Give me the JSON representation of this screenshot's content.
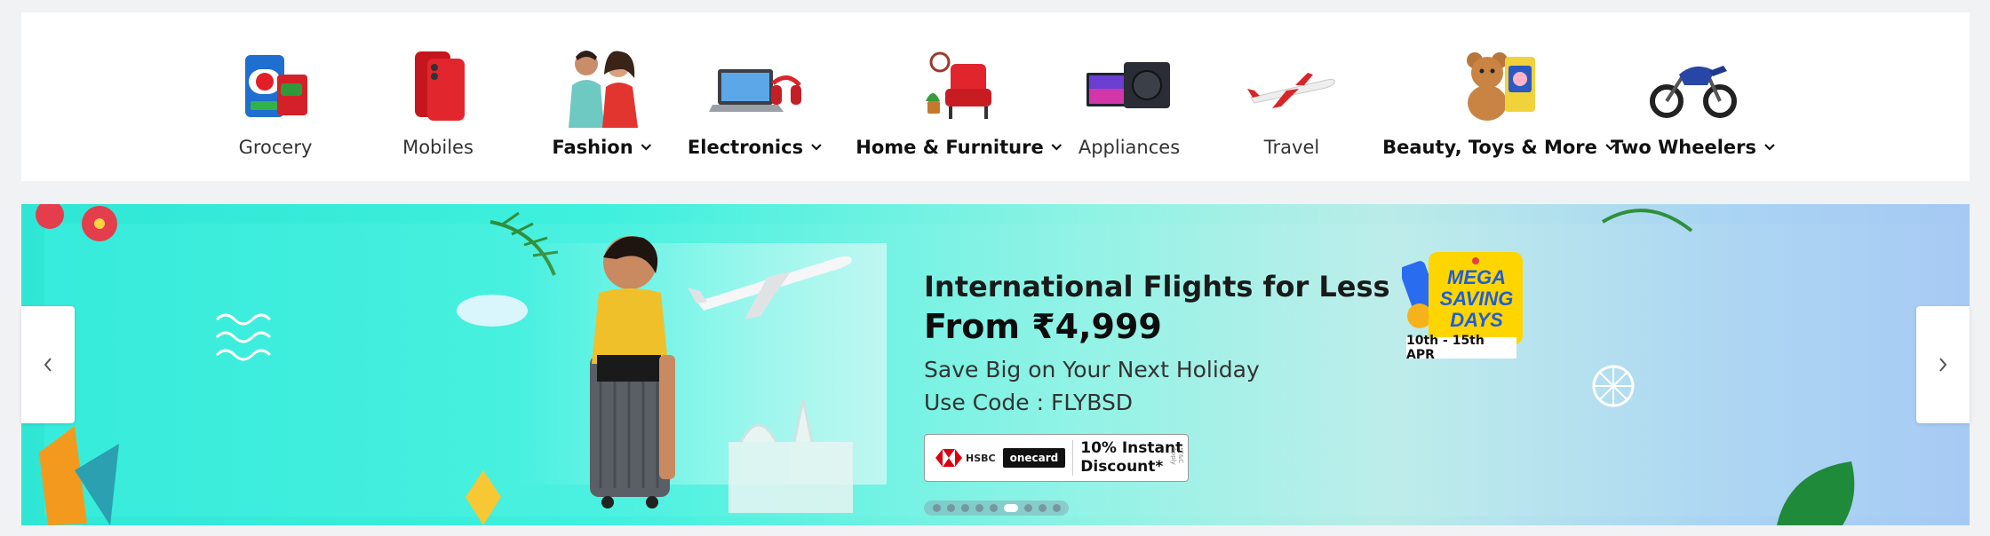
{
  "categories": [
    {
      "label": "Grocery",
      "icon": "grocery-icon",
      "has_dropdown": false
    },
    {
      "label": "Mobiles",
      "icon": "mobiles-icon",
      "has_dropdown": false
    },
    {
      "label": "Fashion",
      "icon": "fashion-icon",
      "has_dropdown": true
    },
    {
      "label": "Electronics",
      "icon": "electronics-icon",
      "has_dropdown": true
    },
    {
      "label": "Home & Furniture",
      "icon": "home-furniture-icon",
      "has_dropdown": true
    },
    {
      "label": "Appliances",
      "icon": "appliances-icon",
      "has_dropdown": false
    },
    {
      "label": "Travel",
      "icon": "travel-icon",
      "has_dropdown": false
    },
    {
      "label": "Beauty, Toys & More",
      "icon": "beauty-toys-icon",
      "has_dropdown": true
    },
    {
      "label": "Two Wheelers",
      "icon": "two-wheelers-icon",
      "has_dropdown": true
    }
  ],
  "banner": {
    "headline": "International Flights for Less",
    "price": "From ₹4,999",
    "subline1": "Save Big on Your Next Holiday",
    "subline2": "Use Code : FLYBSD",
    "offer": {
      "bank1": "HSBC",
      "bank2": "onecard",
      "text_line1": "10% Instant",
      "text_line2": "Discount*",
      "tnc": "*T&C Apply"
    },
    "badge": {
      "line1": "MEGA",
      "line2": "SAVING",
      "line3": "DAYS",
      "dates": "10th - 15th APR"
    },
    "carousel": {
      "total_slides": 9,
      "active_index": 5
    }
  },
  "nav": {
    "prev_icon": "chevron-left-icon",
    "next_icon": "chevron-right-icon"
  },
  "colors": {
    "accent_blue": "#2874f0",
    "badge_yellow": "#ffd500",
    "banner_teal": "#3ff0de",
    "hsbc_red": "#db0011"
  }
}
